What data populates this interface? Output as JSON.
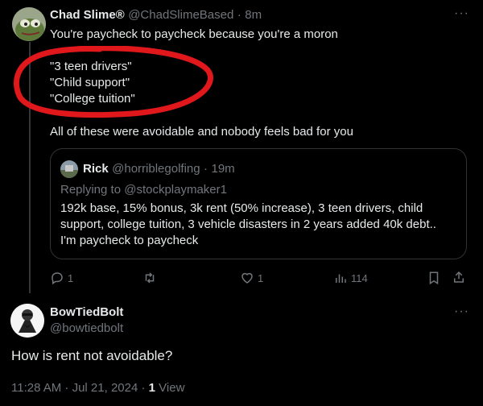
{
  "original_post": {
    "author_name": "Chad Slime®",
    "handle": "@ChadSlimeBased",
    "separator": "·",
    "time": "8m",
    "line1": "You're paycheck to paycheck because you're a moron",
    "quote_line1": "\"3 teen drivers\"",
    "quote_line2": "\"Child support\"",
    "quote_line3": "\"College tuition\"",
    "line2": "All of these were avoidable and nobody feels bad for you"
  },
  "quoted_post": {
    "author_name": "Rick",
    "handle": "@horriblegolfing",
    "separator": "·",
    "time": "19m",
    "replying_to": "Replying to @stockplaymaker1",
    "body_line1": "192k base, 15% bonus, 3k rent (50% increase), 3 teen drivers, child",
    "body_line2": "support, college tuition, 3 vehicle disasters in 2 years added 40k debt..",
    "body_line3": "I'm paycheck to paycheck"
  },
  "actions": {
    "reply_count": "1",
    "retweet_count": "",
    "like_count": "1",
    "views_count": "114"
  },
  "reply_post": {
    "author_name": "BowTiedBolt",
    "handle": "@bowtiedbolt",
    "body": "How is rent not avoidable?",
    "time": "11:28 AM · Jul 21, 2024 · ",
    "views_number": "1",
    "views_label": " View"
  },
  "colors": {
    "background": "#000000",
    "text": "#e7e9ea",
    "muted": "#71767b",
    "annotation": "#e0181b"
  },
  "icons": {
    "more": "more-dots-icon",
    "reply": "reply-icon",
    "retweet": "retweet-icon",
    "like": "heart-icon",
    "views": "views-icon",
    "bookmark": "bookmark-icon",
    "share": "share-icon"
  }
}
